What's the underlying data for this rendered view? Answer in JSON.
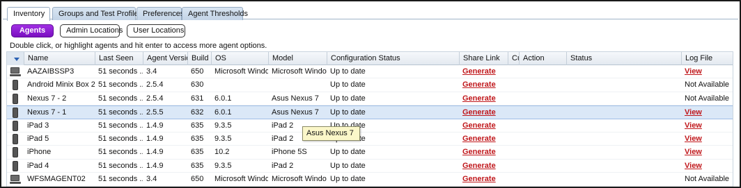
{
  "tabs": [
    {
      "label": "Inventory",
      "active": true
    },
    {
      "label": "Groups and Test Profiles",
      "active": false
    },
    {
      "label": "Preferences",
      "active": false
    },
    {
      "label": "Agent Thresholds",
      "active": false
    }
  ],
  "toggles": [
    {
      "label": "Agents",
      "active": true
    },
    {
      "label": "Admin Locations",
      "active": false
    },
    {
      "label": "User Locations",
      "active": false
    }
  ],
  "hint": "Double click, or highlight agents and hit enter to access more agent options.",
  "columns": [
    "Name",
    "Last Seen",
    "Agent Version",
    "Build",
    "OS",
    "Model",
    "Configuration Status",
    "Share Link",
    "Cu",
    "Action",
    "Status",
    "Log File"
  ],
  "rows": [
    {
      "icon": "laptop-icon",
      "name": "AAZAIBSSP3",
      "last_seen": "51 seconds ...",
      "version": "3.4",
      "build": "650",
      "os": "Microsoft Windo...",
      "model": "Microsoft Windo...",
      "config": "Up to date",
      "share": "Generate",
      "log": "View",
      "log_link": true
    },
    {
      "icon": "phone-icon",
      "name": "Android Minix Box 2",
      "last_seen": "51 seconds ...",
      "version": "2.5.4",
      "build": "630",
      "os": "",
      "model": "",
      "config": "Up to date",
      "share": "Generate",
      "log": "Not Available",
      "log_link": false
    },
    {
      "icon": "phone-icon",
      "name": "Nexus 7 - 2",
      "last_seen": "51 seconds ...",
      "version": "2.5.4",
      "build": "631",
      "os": "6.0.1",
      "model": "Asus Nexus 7",
      "config": "Up to date",
      "share": "Generate",
      "log": "Not Available",
      "log_link": false
    },
    {
      "icon": "phone-icon",
      "name": "Nexus 7 - 1",
      "last_seen": "51 seconds ...",
      "version": "2.5.5",
      "build": "632",
      "os": "6.0.1",
      "model": "Asus Nexus 7",
      "config": "Up to date",
      "share": "Generate",
      "log": "View",
      "log_link": true,
      "selected": true
    },
    {
      "icon": "phone-icon",
      "name": "iPad 3",
      "last_seen": "51 seconds ...",
      "version": "1.4.9",
      "build": "635",
      "os": "9.3.5",
      "model": "iPad 2",
      "config": "Up to date",
      "share": "Generate",
      "log": "View",
      "log_link": true
    },
    {
      "icon": "phone-icon",
      "name": "iPad 5",
      "last_seen": "51 seconds ...",
      "version": "1.4.9",
      "build": "635",
      "os": "9.3.5",
      "model": "iPad 2",
      "config": "Up to date",
      "share": "Generate",
      "log": "View",
      "log_link": true
    },
    {
      "icon": "phone-icon",
      "name": "iPhone",
      "last_seen": "51 seconds ...",
      "version": "1.4.9",
      "build": "635",
      "os": "10.2",
      "model": "iPhone 5S",
      "config": "Up to date",
      "share": "Generate",
      "log": "View",
      "log_link": true
    },
    {
      "icon": "phone-icon",
      "name": "iPad 4",
      "last_seen": "51 seconds ...",
      "version": "1.4.9",
      "build": "635",
      "os": "9.3.5",
      "model": "iPad 2",
      "config": "Up to date",
      "share": "Generate",
      "log": "View",
      "log_link": true
    },
    {
      "icon": "laptop-icon",
      "name": "WFSMAGENT02",
      "last_seen": "51 seconds ...",
      "version": "3.4",
      "build": "650",
      "os": "Microsoft Windo...",
      "model": "Microsoft Windo...",
      "config": "Up to date",
      "share": "Generate",
      "log": "Not Available",
      "log_link": false
    }
  ],
  "tooltip": "Asus Nexus 7",
  "colors": {
    "accent_purple": "#8a1ed6",
    "link_red": "#c0171b",
    "selected_row": "#dbe8f7",
    "tooltip_bg": "#fbf7c9"
  }
}
